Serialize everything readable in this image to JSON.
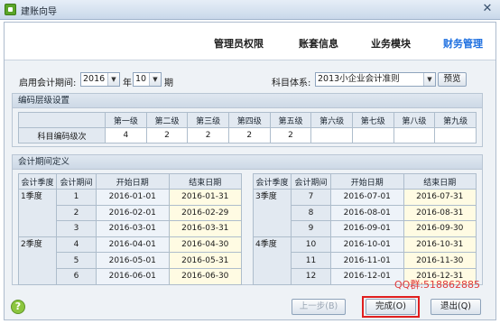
{
  "window": {
    "title": "建账向导",
    "close_glyph": "✕"
  },
  "wizard": {
    "steps": [
      {
        "label": "管理员权限",
        "active": false
      },
      {
        "label": "账套信息",
        "active": false
      },
      {
        "label": "业务模块",
        "active": false
      },
      {
        "label": "财务管理",
        "active": true
      }
    ]
  },
  "form": {
    "start_period_label": "启用会计期间:",
    "year_value": "2016",
    "year_suffix": "年",
    "month_value": "10",
    "month_suffix": "期",
    "subject_system_label": "科目体系:",
    "subject_system_value": "2013小企业会计准则",
    "preview_label": "预览"
  },
  "code_levels": {
    "section_title": "编码层级设置",
    "headers": [
      "",
      "第一级",
      "第二级",
      "第三级",
      "第四级",
      "第五级",
      "第六级",
      "第七级",
      "第八级",
      "第九级"
    ],
    "row_label": "科目编码级次",
    "values": [
      "4",
      "2",
      "2",
      "2",
      "2",
      "",
      "",
      "",
      ""
    ]
  },
  "periods": {
    "section_title": "会计期间定义",
    "headers": [
      "会计季度",
      "会计期间",
      "开始日期",
      "结束日期"
    ],
    "left": [
      {
        "q": "1季度",
        "idx": "1",
        "start": "2016-01-01",
        "end": "2016-01-31"
      },
      {
        "q": "",
        "idx": "2",
        "start": "2016-02-01",
        "end": "2016-02-29"
      },
      {
        "q": "",
        "idx": "3",
        "start": "2016-03-01",
        "end": "2016-03-31"
      },
      {
        "q": "2季度",
        "idx": "4",
        "start": "2016-04-01",
        "end": "2016-04-30"
      },
      {
        "q": "",
        "idx": "5",
        "start": "2016-05-01",
        "end": "2016-05-31"
      },
      {
        "q": "",
        "idx": "6",
        "start": "2016-06-01",
        "end": "2016-06-30"
      }
    ],
    "right": [
      {
        "q": "3季度",
        "idx": "7",
        "start": "2016-07-01",
        "end": "2016-07-31"
      },
      {
        "q": "",
        "idx": "8",
        "start": "2016-08-01",
        "end": "2016-08-31"
      },
      {
        "q": "",
        "idx": "9",
        "start": "2016-09-01",
        "end": "2016-09-30"
      },
      {
        "q": "4季度",
        "idx": "10",
        "start": "2016-10-01",
        "end": "2016-10-31"
      },
      {
        "q": "",
        "idx": "11",
        "start": "2016-11-01",
        "end": "2016-11-30"
      },
      {
        "q": "",
        "idx": "12",
        "start": "2016-12-01",
        "end": "2016-12-31"
      }
    ]
  },
  "footer": {
    "help_glyph": "?",
    "qq_text": "QQ群:518862885",
    "prev_label": "上一步(B)",
    "finish_label": "完成(O)",
    "exit_label": "退出(Q)"
  }
}
